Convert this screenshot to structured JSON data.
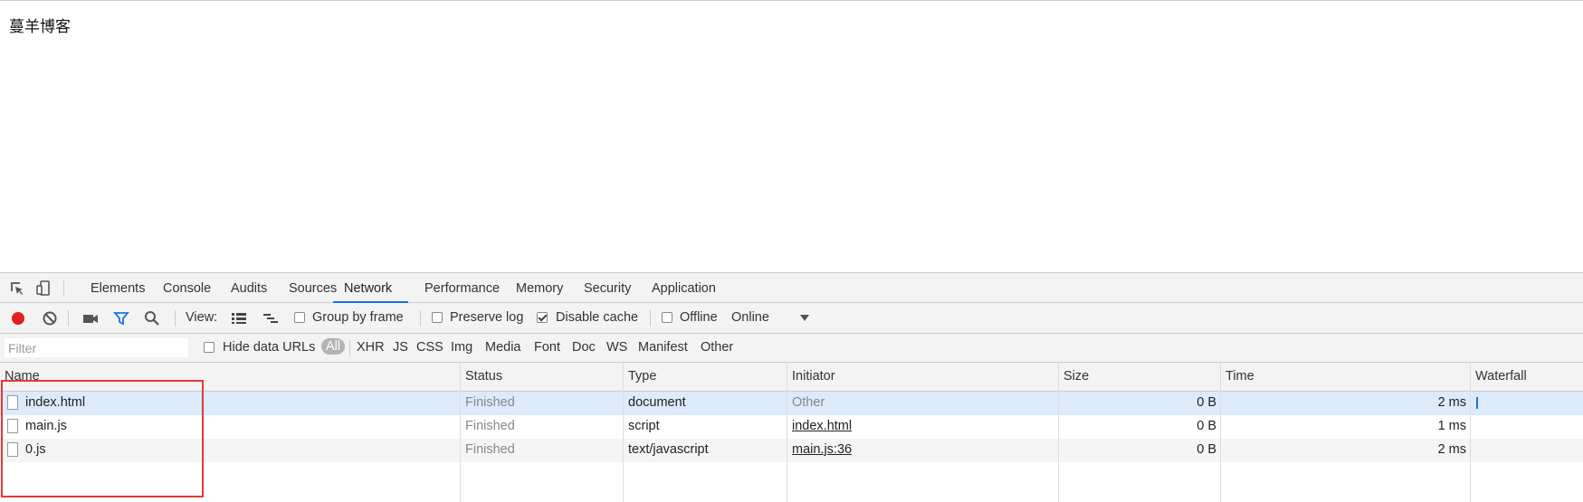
{
  "page": {
    "text": "蔓羊博客"
  },
  "devtools": {
    "tabs": [
      {
        "label": "Elements"
      },
      {
        "label": "Console"
      },
      {
        "label": "Audits"
      },
      {
        "label": "Sources"
      },
      {
        "label": "Network"
      },
      {
        "label": "Performance"
      },
      {
        "label": "Memory"
      },
      {
        "label": "Security"
      },
      {
        "label": "Application"
      }
    ],
    "active_tab": "Network",
    "toolbar": {
      "view_label": "View:",
      "group_by_frame": "Group by frame",
      "preserve_log": "Preserve log",
      "disable_cache": "Disable cache",
      "offline": "Offline",
      "throttling": "Online"
    },
    "filter": {
      "placeholder": "Filter",
      "hide_data_urls": "Hide data URLs",
      "types": [
        "All",
        "XHR",
        "JS",
        "CSS",
        "Img",
        "Media",
        "Font",
        "Doc",
        "WS",
        "Manifest",
        "Other"
      ]
    },
    "columns": {
      "name": "Name",
      "status": "Status",
      "type": "Type",
      "initiator": "Initiator",
      "size": "Size",
      "time": "Time",
      "waterfall": "Waterfall"
    },
    "rows": [
      {
        "name": "index.html",
        "status": "Finished",
        "type": "document",
        "initiator": "Other",
        "size": "0 B",
        "time": "2 ms"
      },
      {
        "name": "main.js",
        "status": "Finished",
        "type": "script",
        "initiator": "index.html",
        "size": "0 B",
        "time": "1 ms"
      },
      {
        "name": "0.js",
        "status": "Finished",
        "type": "text/javascript",
        "initiator": "main.js:36",
        "size": "0 B",
        "time": "2 ms"
      }
    ]
  },
  "colors": {
    "accent": "#1a73e8",
    "record": "#e02020",
    "highlight": "#e53935",
    "selected_row": "#dcebfb"
  }
}
